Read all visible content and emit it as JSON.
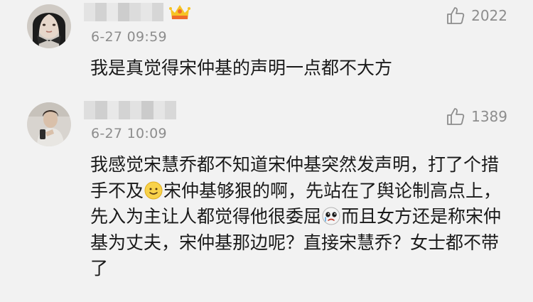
{
  "comments": [
    {
      "timestamp": "6-27 09:59",
      "likes": "2022",
      "badge": "crown-badge",
      "text": "我是真觉得宋仲基的声明一点都不大方"
    },
    {
      "timestamp": "6-27 10:09",
      "likes": "1389",
      "segments": {
        "s1": "我感觉宋慧乔都不知道宋仲基突然发声明，打了个措手不及",
        "s2": "宋仲基够狠的啊，先站在了舆论制高点上，先入为主让人都觉得他很委屈",
        "s3": "而且女方还是称宋仲基为丈夫，宋仲基那边呢？直接宋慧乔？女士都不带了"
      }
    }
  ],
  "colors": {
    "background": "#f2f2f2",
    "text": "#1a1a1a",
    "meta": "#8d8d8d",
    "crown_yellow": "#f6c324",
    "crown_orange": "#ef6b2a"
  }
}
